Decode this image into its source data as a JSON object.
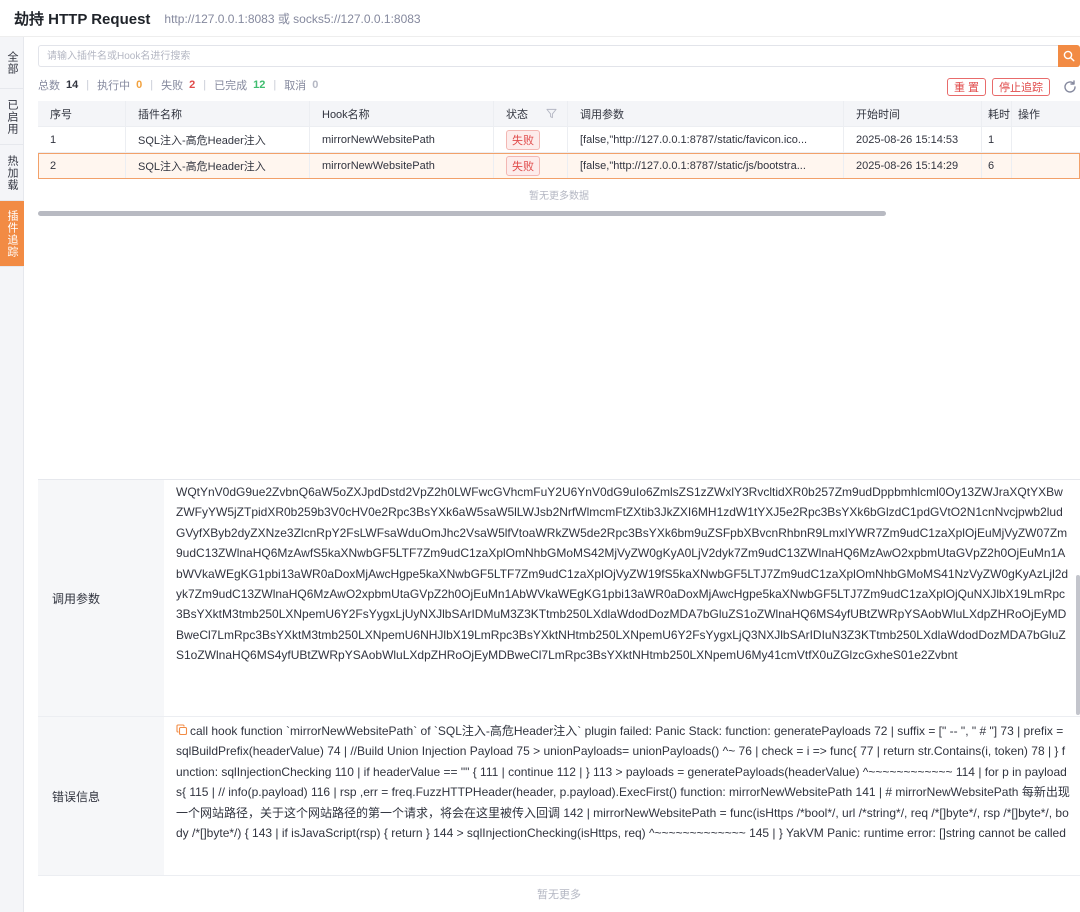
{
  "header": {
    "title": "劫持 HTTP Request",
    "subtitle": "http://127.0.0.1:8083 或 socks5://127.0.0.1:8083"
  },
  "side_tabs": [
    {
      "label": "全部"
    },
    {
      "label": "已启用"
    },
    {
      "label": "热加载"
    },
    {
      "label": "插件追踪"
    }
  ],
  "search": {
    "placeholder": "请输入插件名或Hook名进行搜索",
    "value": ""
  },
  "stats": {
    "total_label": "总数",
    "total": "14",
    "running_label": "执行中",
    "running": "0",
    "fail_label": "失败",
    "fail": "2",
    "done_label": "已完成",
    "done": "12",
    "cancel_label": "取消",
    "cancel": "0"
  },
  "actions": {
    "reset": "重 置",
    "stop_trace": "停止追踪"
  },
  "table": {
    "columns": [
      "序号",
      "插件名称",
      "Hook名称",
      "状态",
      "调用参数",
      "开始时间",
      "耗时",
      "操作"
    ],
    "rows": [
      {
        "index": "1",
        "plugin": "SQL注入-高危Header注入",
        "hook": "mirrorNewWebsitePath",
        "status": "失败",
        "params": "[false,\"http://127.0.0.1:8787/static/favicon.ico...",
        "start": "2025-08-26 15:14:53",
        "cost": "1"
      },
      {
        "index": "2",
        "plugin": "SQL注入-高危Header注入",
        "hook": "mirrorNewWebsitePath",
        "status": "失败",
        "params": "[false,\"http://127.0.0.1:8787/static/js/bootstra...",
        "start": "2025-08-26 15:14:29",
        "cost": "6"
      }
    ],
    "no_more": "暂无更多数据"
  },
  "detail": {
    "params_label": "调用参数",
    "params_value": "WQtYnV0dG9ue2ZvbnQ6aW5oZXJpdDstd2VpZ2h0LWFwcGVhcmFuY2U6YnV0dG9uIo6ZmlsZS1zZWxlY3RvcltidXR0b257Zm9udDppbmhlcml0Oy13ZWJraXQtYXBwZWFyYW5jZTpidXR0b259b3V0cHV0e2Rpc3BsYXk6aW5saW5lLWJsb2NrfWlmcmFtZXtib3JkZXI6MH1zdW1tYXJ5e2Rpc3BsYXk6bGlzdC1pdGVtO2N1cnNvcjpwb2ludGVyfXByb2dyZXNze3ZlcnRpY2FsLWFsaWduOmJhc2VsaW5lfVtoaWRkZW5de2Rpc3BsYXk6bm9uZSFpbXBvcnRhbnR9LmxlYWR7Zm9udC1zaXplOjEuMjVyZW07Zm9udC13ZWlnaHQ6MzAwfS5kaXNwbGF5LTF7Zm9udC1zaXplOmNhbGMoMS42MjVyZW0gKyA0LjV2dyk7Zm9udC13ZWlnaHQ6MzAwO2xpbmUtaGVpZ2h0OjEuMn1AbWVkaWEgKG1pbi13aWR0aDoxMjAwcHgpe5kaXNwbGF5LTF7Zm9udC1zaXplOjVyZW19fS5kaXNwbGF5LTJ7Zm9udC1zaXplOmNhbGMoMS41NzVyZW0gKyAzLjl2dyk7Zm9udC13ZWlnaHQ6MzAwO2xpbmUtaGVpZ2h0OjEuMn1AbWVkaWEgKG1pbi13aWR0aDoxMjAwcHgpe5kaXNwbGF5LTJ7Zm9udC1zaXplOjQuNXJlbX19LmRpc3BsYXktM3tmb250LXNpemU6Y2FsYygxLjUyNXJlbSArIDMuM3Z3KTtmb250LXdlaWdodDozMDA7bGluZS1oZWlnaHQ6MS4yfUBtZWRpYSAobWluLXdpZHRoOjEyMDBweCl7LmRpc3BsYXktM3tmb250LXNpemU6NHJlbX19LmRpc3BsYXktNHtmb250LXNpemU6Y2FsYygxLjQ3NXJlbSArIDIuN3Z3KTtmb250LXdlaWdodDozMDA7bGluZS1oZWlnaHQ6MS4yfUBtZWRpYSAobWluLXdpZHRoOjEyMDBweCl7LmRpc3BsYXktNHtmb250LXNpemU6My41cmVtfX0uZGlzcGxheS01e2Zvbnt",
    "error_label": "错误信息",
    "error_value": "call hook function `mirrorNewWebsitePath` of `SQL注入-高危Header注入` plugin failed: Panic Stack: function: generatePayloads 72 | suffix = [\" -- \", \" # \"] 73 | prefix = sqlBuildPrefix(headerValue) 74 | //Build Union Injection Payload 75 > unionPayloads= unionPayloads() ^~ 76 | check = i => func{ 77 | return str.Contains(i, token) 78 | } function: sqlInjectionChecking 110 | if headerValue == \"\" { 111 | continue 112 | } 113 > payloads = generatePayloads(headerValue) ^~~~~~~~~~~~~ 114 | for p in payloads{ 115 | // info(p.payload) 116 | rsp ,err = freq.FuzzHTTPHeader(header, p.payload).ExecFirst() function: mirrorNewWebsitePath 141 | # mirrorNewWebsitePath 每新出现一个网站路径，关于这个网站路径的第一个请求，将会在这里被传入回调 142 | mirrorNewWebsitePath = func(isHttps /*bool*/, url /*string*/, req /*[]byte*/, rsp /*[]byte*/, body /*[]byte*/) { 143 | if isJavaScript(rsp) { return } 144 > sqlInjectionChecking(isHttps, req) ^~~~~~~~~~~~~~ 145 | } YakVM Panic: runtime error: []string cannot be called",
    "no_more": "暂无更多"
  },
  "colors": {
    "accent": "#f28b44",
    "fail": "#e04b4b",
    "running": "#f2a13d",
    "done": "#3fbd6f"
  }
}
